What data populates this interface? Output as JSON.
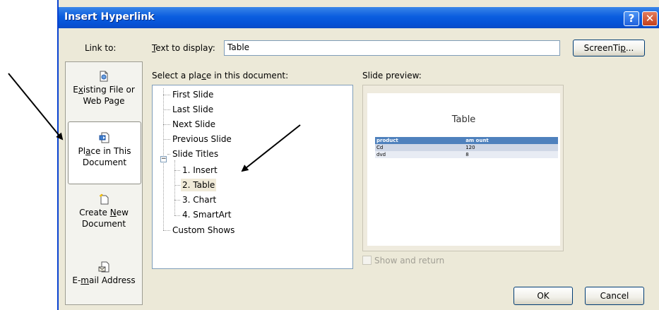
{
  "dialog": {
    "title": "Insert Hyperlink",
    "help_glyph": "?",
    "close_glyph": "✕"
  },
  "link_to": {
    "label": "Link to:",
    "items": [
      {
        "pre": "E",
        "key": "x",
        "post": "isting File or",
        "line2": "Web Page",
        "icon": "file-icon"
      },
      {
        "pre": "Pl",
        "key": "a",
        "post": "ce in This",
        "line2": "Document",
        "icon": "document-place-icon"
      },
      {
        "pre": "Create ",
        "key": "N",
        "post": "ew",
        "line2": "Document",
        "icon": "new-document-icon"
      },
      {
        "pre": "E-",
        "key": "m",
        "post": "ail Address",
        "line2": "",
        "icon": "email-icon"
      }
    ]
  },
  "text_to_display": {
    "label_key": "T",
    "label_rest": "ext to display:",
    "value": "Table"
  },
  "screentip_button": {
    "pre": "ScreenTi",
    "key": "p",
    "post": "..."
  },
  "place_panel": {
    "label_pre": "Select a pla",
    "label_key": "c",
    "label_post": "e in this document:",
    "items": {
      "first": "First Slide",
      "last": "Last Slide",
      "next": "Next Slide",
      "previous": "Previous Slide",
      "slide_titles": "Slide Titles",
      "s1": "1. Insert",
      "s2": "2. Table",
      "s3": "3. Chart",
      "s4": "4. SmartArt",
      "custom": "Custom Shows"
    },
    "expander_glyph": "−"
  },
  "preview": {
    "label": "Slide preview:",
    "slide_title": "Table",
    "table": {
      "headers": [
        "product",
        "am ount"
      ],
      "rows": [
        [
          "Cd",
          "120"
        ],
        [
          "dvd",
          "8"
        ]
      ]
    }
  },
  "show_and_return": {
    "label": "Show and return",
    "checked": false,
    "enabled": false
  },
  "buttons": {
    "ok": "OK",
    "cancel": "Cancel"
  }
}
